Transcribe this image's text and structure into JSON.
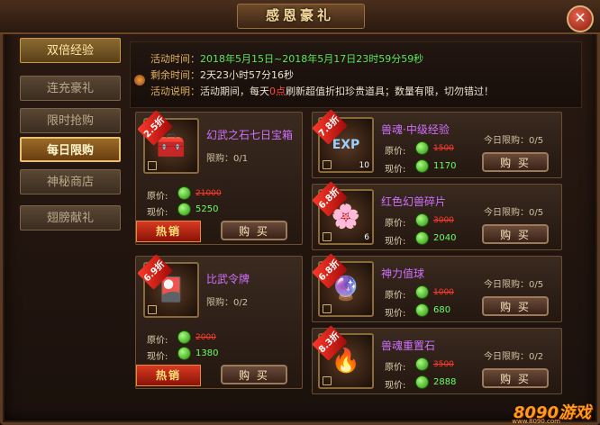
{
  "title": "感恩豪礼",
  "close_label": "✕",
  "sidebar": {
    "items": [
      {
        "label": "双倍经验"
      },
      {
        "label": "连充豪礼"
      },
      {
        "label": "限时抢购"
      },
      {
        "label": "每日限购"
      },
      {
        "label": "神秘商店"
      },
      {
        "label": "翅膀献礼"
      }
    ]
  },
  "info": {
    "time_label": "活动时间：",
    "time_value": "2018年5月15日~2018年5月17日23时59分59秒",
    "remain_label": "剩余时间：",
    "remain_value": "2天23小时57分16秒",
    "desc_label": "活动说明：",
    "desc_pre": "活动期间，每天",
    "desc_highlight": "0点",
    "desc_post": "刷新超值折扣珍贵道具；数量有限，切勿错过！"
  },
  "labels": {
    "original_price": "原价:",
    "current_price": "现价:",
    "buy": "购 买",
    "hot": "热销"
  },
  "left_items": [
    {
      "discount": "2.5折",
      "name": "幻武之石七日宝箱",
      "limit": "限购：0/1",
      "old_price": "21000",
      "new_price": "5250"
    },
    {
      "discount": "6.9折",
      "name": "比武令牌",
      "limit": "限购：0/2",
      "old_price": "2000",
      "new_price": "1380"
    }
  ],
  "right_items": [
    {
      "discount": "7.8折",
      "name": "兽魂·中级经验",
      "limit": "今日限购：0/5",
      "old_price": "1500",
      "new_price": "1170",
      "qty": "10"
    },
    {
      "discount": "6.8折",
      "name": "红色幻兽碎片",
      "limit": "今日限购：0/5",
      "old_price": "3000",
      "new_price": "2040",
      "qty": "6"
    },
    {
      "discount": "6.8折",
      "name": "神力值球",
      "limit": "今日限购：0/5",
      "old_price": "1000",
      "new_price": "680",
      "qty": ""
    },
    {
      "discount": "8.3折",
      "name": "兽魂重置石",
      "limit": "今日限购：0/2",
      "old_price": "3500",
      "new_price": "2888",
      "qty": ""
    }
  ],
  "logo": {
    "text": "8090游戏",
    "sub": "www.8090.com"
  }
}
